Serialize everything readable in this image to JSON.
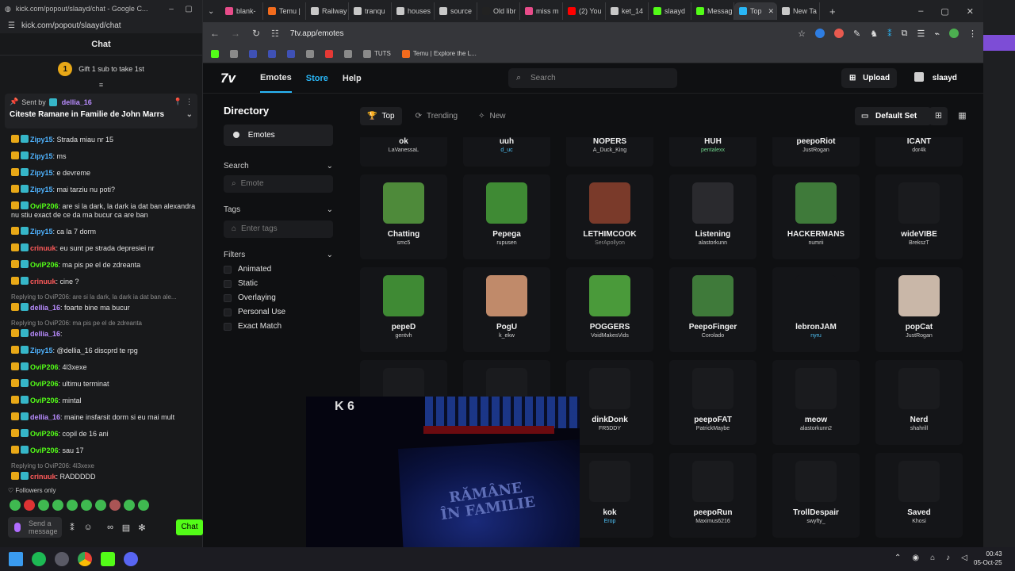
{
  "kick": {
    "window_title": "kick.com/popout/slaayd/chat - Google C...",
    "url": "kick.com/popout/slaayd/chat",
    "chat_heading": "Chat",
    "gift_text": "Gift 1 sub to take 1st",
    "gift_count": "1",
    "pinned_sent_by": "Sent by",
    "pinned_user": "dellia_16",
    "pinned_title": "Citeste Ramane in Familie de John Marrs",
    "messages": [
      {
        "user": "Zipy15",
        "color": "#4fb3ff",
        "text": ": Strada miau nr 15"
      },
      {
        "user": "Zipy15",
        "color": "#4fb3ff",
        "text": ": ms"
      },
      {
        "user": "Zipy15",
        "color": "#4fb3ff",
        "text": ": e devreme"
      },
      {
        "user": "Zipy15",
        "color": "#4fb3ff",
        "text": ": mai tarziu nu poti?"
      },
      {
        "user": "OviP206",
        "color": "#53fc18",
        "text": ": are si la dark, la dark ia dat ban alexandra nu stiu exact de ce da ma bucur ca are ban"
      },
      {
        "user": "Zipy15",
        "color": "#4fb3ff",
        "text": ": ca la 7 dorm"
      },
      {
        "user": "crinuuk",
        "color": "#ff5a5a",
        "text": ": eu sunt pe strada depresiei nr"
      },
      {
        "user": "OviP206",
        "color": "#53fc18",
        "text": ": ma pis pe el de zdreanta"
      },
      {
        "user": "crinuuk",
        "color": "#ff5a5a",
        "text": ": cine ?"
      },
      {
        "reply": "Replying to OviP206: are si la dark, la dark ia dat ban ale...",
        "user": "dellia_16",
        "color": "#b98cff",
        "text": ": foarte bine ma bucur"
      },
      {
        "reply": "Replying to OviP206: ma pis pe el de zdreanta",
        "user": "dellia_16",
        "color": "#b98cff",
        "text": ":"
      },
      {
        "user": "Zipy15",
        "color": "#4fb3ff",
        "text": ": @dellia_16 discprd te rpg"
      },
      {
        "user": "OviP206",
        "color": "#53fc18",
        "text": ": 4l3xexe"
      },
      {
        "user": "OviP206",
        "color": "#53fc18",
        "text": ": ultimu terminat"
      },
      {
        "user": "OviP206",
        "color": "#53fc18",
        "text": ": mintal"
      },
      {
        "user": "dellia_16",
        "color": "#b98cff",
        "text": ": maine insfarsit dorm si eu mai mult"
      },
      {
        "user": "OviP206",
        "color": "#53fc18",
        "text": ": copil de 16 ani"
      },
      {
        "user": "OviP206",
        "color": "#53fc18",
        "text": ": sau 17"
      },
      {
        "reply": "Replying to OviP206: 4l3xexe",
        "user": "crinuuk",
        "color": "#ff5a5a",
        "text": ": RADDDDD"
      }
    ],
    "followers_only": "Followers only",
    "input_placeholder": "Send a message",
    "chat_button": "Chat"
  },
  "chrome": {
    "tabs": [
      {
        "label": "blank-",
        "color": "#e84c8a"
      },
      {
        "label": "Temu |",
        "color": "#f26b1d"
      },
      {
        "label": "Railway",
        "color": "#c8c8c8"
      },
      {
        "label": "tranqu",
        "color": "#c8c8c8"
      },
      {
        "label": "houses",
        "color": "#c8c8c8"
      },
      {
        "label": "source",
        "color": "#c8c8c8"
      },
      {
        "label": "Old libr",
        "color": "#222222"
      },
      {
        "label": "miss m",
        "color": "#e84c8a"
      },
      {
        "label": "(2) You",
        "color": "#ff0000"
      },
      {
        "label": "ket_14",
        "color": "#c8c8c8"
      },
      {
        "label": "slaayd",
        "color": "#53fc18"
      },
      {
        "label": "Messag",
        "color": "#53fc18"
      },
      {
        "label": "Top",
        "color": "#29b6f6"
      },
      {
        "label": "New Ta",
        "color": "#c8c8c8"
      }
    ],
    "url": "7tv.app/emotes",
    "bookmarks": [
      {
        "label": "",
        "color": "#53fc18"
      },
      {
        "label": "",
        "color": "#8a8a8a"
      },
      {
        "label": "",
        "color": "#3f51b5"
      },
      {
        "label": "",
        "color": "#3f51b5"
      },
      {
        "label": "",
        "color": "#3f51b5"
      },
      {
        "label": "",
        "color": "#8a8a8a"
      },
      {
        "label": "",
        "color": "#e53935"
      },
      {
        "label": "",
        "color": "#8a8a8a"
      },
      {
        "label": "TUTS",
        "color": "#8a8a8a"
      },
      {
        "label": "Temu | Explore the L...",
        "color": "#f26b1d"
      }
    ]
  },
  "seventv": {
    "logo": "7v",
    "nav": {
      "emotes": "Emotes",
      "store": "Store",
      "help": "Help"
    },
    "search_placeholder": "Search",
    "upload": "Upload",
    "username": "slaayd",
    "sidebar": {
      "directory": "Directory",
      "emotes_button": "Emotes",
      "search_label": "Search",
      "emote_placeholder": "Emote",
      "tags_label": "Tags",
      "tags_placeholder": "Enter tags",
      "filters_label": "Filters",
      "filters": [
        "Animated",
        "Static",
        "Overlaying",
        "Personal Use",
        "Exact Match"
      ]
    },
    "sort_tabs": [
      {
        "label": "Top",
        "icon": "trophy-icon"
      },
      {
        "label": "Trending",
        "icon": "flame-icon"
      },
      {
        "label": "New",
        "icon": "sparkle-icon"
      }
    ],
    "default_set": "Default Set",
    "emotes": [
      {
        "name": "ok",
        "author": "LaVanessaL",
        "author_color": "#cfcfcf",
        "img": ""
      },
      {
        "name": "uuh",
        "author": "d_uc",
        "author_color": "#4fc3f7",
        "img": ""
      },
      {
        "name": "NOPERS",
        "author": "A_Duck_King",
        "author_color": "#cfcfcf",
        "img": ""
      },
      {
        "name": "HUH",
        "author": "pentalexx",
        "author_color": "#6fd38a",
        "img": ""
      },
      {
        "name": "peepoRiot",
        "author": "JustRogan",
        "author_color": "#cfcfcf",
        "img": ""
      },
      {
        "name": "ICANT",
        "author": "dor4k",
        "author_color": "#cfcfcf",
        "img": ""
      },
      {
        "name": "Chatting",
        "author": "smc5",
        "author_color": "#cfcfcf",
        "img": "#4e8a3a"
      },
      {
        "name": "Pepega",
        "author": "rupusen",
        "author_color": "#cfcfcf",
        "img": "#3f8a34"
      },
      {
        "name": "LETHIMCOOK",
        "author": "SerApollyon",
        "author_color": "#8f8f8f",
        "img": "#7a3a2a"
      },
      {
        "name": "Listening",
        "author": "alastorkunn",
        "author_color": "#cfcfcf",
        "img": "#2a2a2e"
      },
      {
        "name": "HACKERMANS",
        "author": "numrii",
        "author_color": "#cfcfcf",
        "img": "#3f7a3a"
      },
      {
        "name": "wideVIBE",
        "author": "BrekszT",
        "author_color": "#cfcfcf",
        "img": "#1a1b1e"
      },
      {
        "name": "pepeD",
        "author": "gentvh",
        "author_color": "#cfcfcf",
        "img": "#3f8a34"
      },
      {
        "name": "PogU",
        "author": "k_ekw",
        "author_color": "#cfcfcf",
        "img": "#c08a6a"
      },
      {
        "name": "POGGERS",
        "author": "VoidMakesVids",
        "author_color": "#cfcfcf",
        "img": "#4a9a3a"
      },
      {
        "name": "PeepoFinger",
        "author": "Corolado",
        "author_color": "#cfcfcf",
        "img": "#3f7a3a"
      },
      {
        "name": "lebronJAM",
        "author": "nyru",
        "author_color": "#4fc3f7",
        "img": "#141518"
      },
      {
        "name": "popCat",
        "author": "JustRogan",
        "author_color": "#cfcfcf",
        "img": "#c9b7a8"
      },
      {
        "name": "",
        "author": "",
        "author_color": "#cfcfcf",
        "img": "#1a1b1e"
      },
      {
        "name": "",
        "author": "",
        "author_color": "#cfcfcf",
        "img": "#1a1b1e"
      },
      {
        "name": "dinkDonk",
        "author": "FR5DDY",
        "author_color": "#cfcfcf",
        "img": "#1a1b1e"
      },
      {
        "name": "peepoFAT",
        "author": "PatrickMaybe",
        "author_color": "#cfcfcf",
        "img": "#1a1b1e"
      },
      {
        "name": "meow",
        "author": "alastorkunn2",
        "author_color": "#cfcfcf",
        "img": "#1a1b1e"
      },
      {
        "name": "Nerd",
        "author": "shahrill",
        "author_color": "#cfcfcf",
        "img": "#1a1b1e"
      },
      {
        "name": "",
        "author": "",
        "author_color": "#cfcfcf",
        "img": "#1a1b1e"
      },
      {
        "name": "",
        "author": "",
        "author_color": "#cfcfcf",
        "img": "#1a1b1e"
      },
      {
        "name": "kok",
        "author": "Erop",
        "author_color": "#4fc3f7",
        "img": "#1a1b1e"
      },
      {
        "name": "peepoRun",
        "author": "Maximus6216",
        "author_color": "#cfcfcf",
        "img": "#1a1b1e"
      },
      {
        "name": "TrollDespair",
        "author": "swyfty_",
        "author_color": "#cfcfcf",
        "img": "#1a1b1e"
      },
      {
        "name": "Saved",
        "author": "Khosi",
        "author_color": "#cfcfcf",
        "img": "#1a1b1e"
      }
    ]
  },
  "video": {
    "channel_badge": "K 6",
    "book_title": "RĂMÂNE ÎN FAMILIE"
  },
  "taskbar": {
    "time": "00:43",
    "date": "05-Oct-25"
  }
}
